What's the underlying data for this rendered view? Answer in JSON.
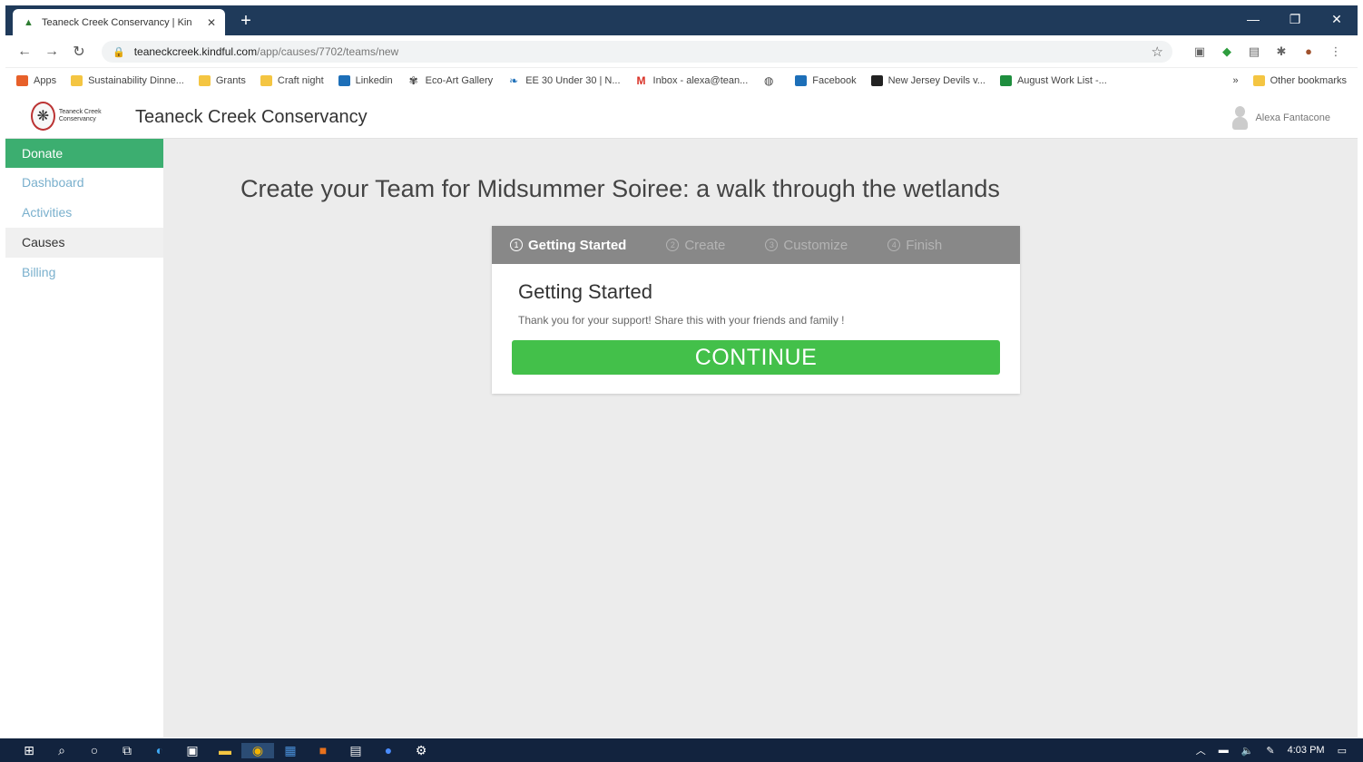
{
  "browser": {
    "tab_title": "Teaneck Creek Conservancy | Kin",
    "tab_close": "✕",
    "new_tab": "+",
    "url_domain": "teaneckcreek.kindful.com",
    "url_path": "/app/causes/7702/teams/new",
    "window_buttons": {
      "minimize": "—",
      "restore": "❐",
      "close": "✕"
    }
  },
  "bookmarks": {
    "items": [
      "Apps",
      "Sustainability Dinne...",
      "Grants",
      "Craft night",
      "Linkedin",
      "Eco-Art Gallery",
      "EE 30 Under 30 | N...",
      "Inbox - alexa@tean...",
      "",
      "Facebook",
      "New Jersey Devils v...",
      "August Work List -..."
    ],
    "overflow": "»",
    "other": "Other bookmarks"
  },
  "header": {
    "logo_text": "Teaneck Creek Conservancy",
    "app_name": "Teaneck Creek Conservancy",
    "user_name": "Alexa Fantacone"
  },
  "sidebar": {
    "items": [
      {
        "label": "Donate"
      },
      {
        "label": "Dashboard"
      },
      {
        "label": "Activities"
      },
      {
        "label": "Causes"
      },
      {
        "label": "Billing"
      }
    ]
  },
  "main": {
    "title": "Create your Team for Midsummer Soiree: a walk through the wetlands",
    "steps": [
      {
        "num": "1",
        "label": "Getting Started"
      },
      {
        "num": "2",
        "label": "Create"
      },
      {
        "num": "3",
        "label": "Customize"
      },
      {
        "num": "4",
        "label": "Finish"
      }
    ],
    "card_heading": "Getting Started",
    "card_text": "Thank you for your support! Share this with your friends and family !",
    "continue_label": "CONTINUE"
  },
  "taskbar": {
    "time": "4:03 PM"
  }
}
